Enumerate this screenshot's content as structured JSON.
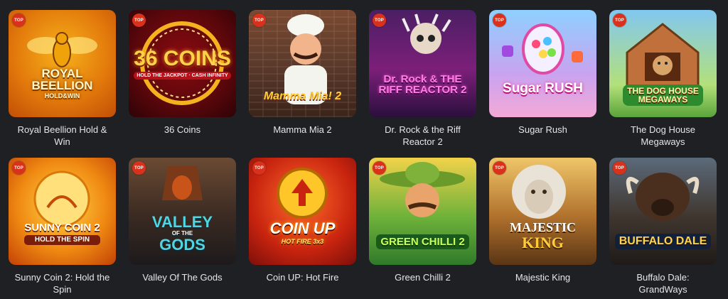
{
  "badge_label": "TOP",
  "games": [
    {
      "title": "Royal Beellion Hold & Win",
      "logo_main": "ROYAL BEELLION",
      "logo_sub": "HOLD&WIN",
      "icon": "bee-icon"
    },
    {
      "title": "36 Coins",
      "logo_main": "36 COINS",
      "logo_sub": "HOLD THE JACKPOT · CASH INFINITY",
      "icon": "coin-icon"
    },
    {
      "title": "Mamma Mia 2",
      "logo_main": "Mamma Mia! 2",
      "logo_sub": "",
      "icon": "chef-icon"
    },
    {
      "title": "Dr. Rock & the Riff Reactor 2",
      "logo_main": "Dr. Rock & THE RIFF REACTOR 2",
      "logo_sub": "",
      "icon": "guitar-icon"
    },
    {
      "title": "Sugar Rush",
      "logo_main": "Sugar RUSH",
      "logo_sub": "",
      "icon": "candy-icon"
    },
    {
      "title": "The Dog House Megaways",
      "logo_main": "THE DOG HOUSE",
      "logo_sub": "MEGAWAYS",
      "icon": "dog-icon"
    },
    {
      "title": "Sunny Coin 2: Hold the Spin",
      "logo_main": "SUNNY COIN 2",
      "logo_sub": "HOLD THE SPIN",
      "icon": "sun-icon"
    },
    {
      "title": "Valley Of The Gods",
      "logo_main": "VALLEY",
      "logo_sub": "OF THE",
      "logo_sub2": "GODS",
      "icon": "pharaoh-icon"
    },
    {
      "title": "Coin UP: Hot Fire",
      "logo_main": "COIN UP",
      "logo_sub": "HOT FIRE 3x3",
      "icon": "up-coin-icon"
    },
    {
      "title": "Green Chilli 2",
      "logo_main": "GREEN CHILLI 2",
      "logo_sub": "",
      "icon": "sombrero-icon"
    },
    {
      "title": "Majestic King",
      "logo_main": "MAJESTIC",
      "logo_sub": "KING",
      "icon": "lion-icon"
    },
    {
      "title": "Buffalo Dale: GrandWays",
      "logo_main": "BUFFALO DALE",
      "logo_sub": "",
      "icon": "buffalo-icon"
    }
  ]
}
